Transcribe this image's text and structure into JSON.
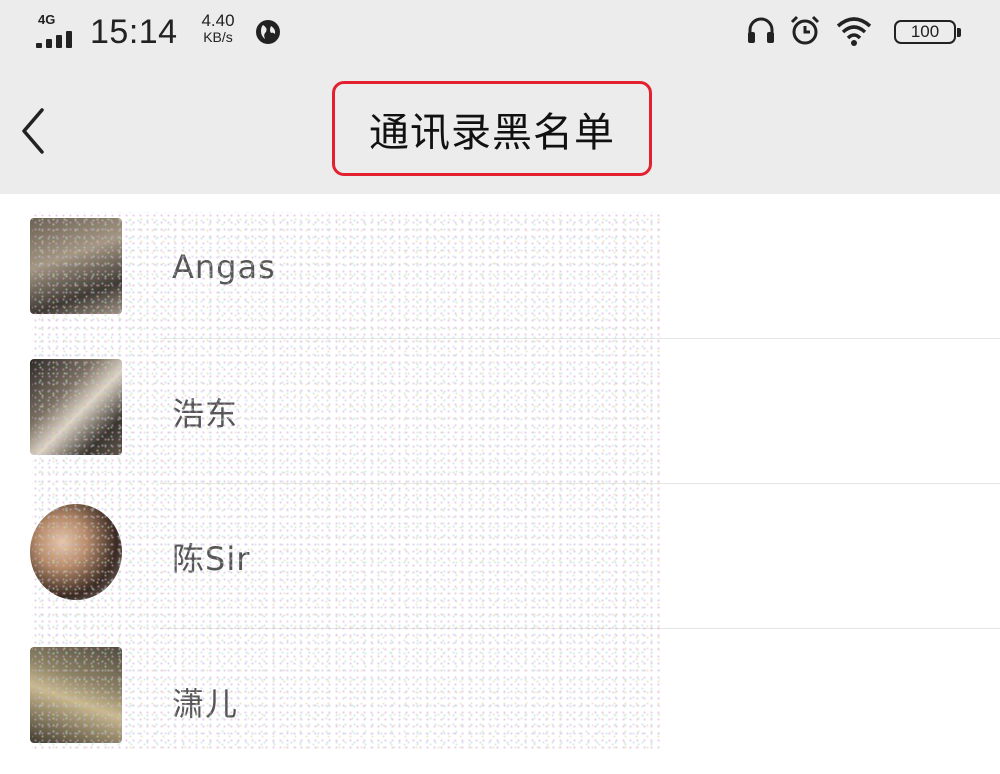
{
  "status_bar": {
    "network": "4G",
    "time": "15:14",
    "speed_value": "4.40",
    "speed_unit": "KB/s",
    "battery": "100",
    "icons": [
      "signal-icon",
      "globe-icon",
      "headphones-icon",
      "alarm-icon",
      "wifi-icon",
      "battery-icon"
    ]
  },
  "header": {
    "title": "通讯录黑名单",
    "back_icon": "back-chevron-icon",
    "highlight_color": "#e2202f"
  },
  "contacts": [
    {
      "name": "Angas"
    },
    {
      "name": "浩东"
    },
    {
      "name": "陈Sir"
    },
    {
      "name": "潇儿"
    }
  ]
}
